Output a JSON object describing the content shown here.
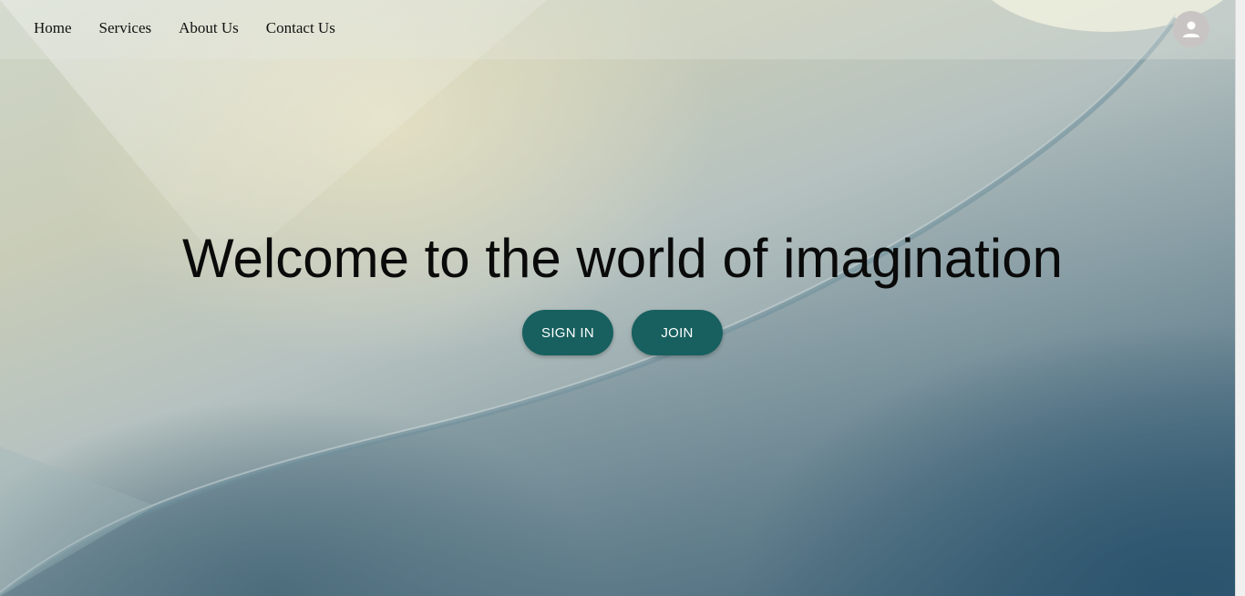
{
  "nav": {
    "items": [
      {
        "label": "Home"
      },
      {
        "label": "Services"
      },
      {
        "label": "About Us"
      },
      {
        "label": "Contact Us"
      }
    ],
    "avatar_icon": "person-icon"
  },
  "hero": {
    "headline": "Welcome to the world of imagination",
    "buttons": {
      "sign_in": "SIGN IN",
      "join": "JOIN"
    }
  },
  "colors": {
    "button_bg": "#17605f",
    "button_text": "#ffffff",
    "avatar_bg": "#c9c4c4"
  }
}
